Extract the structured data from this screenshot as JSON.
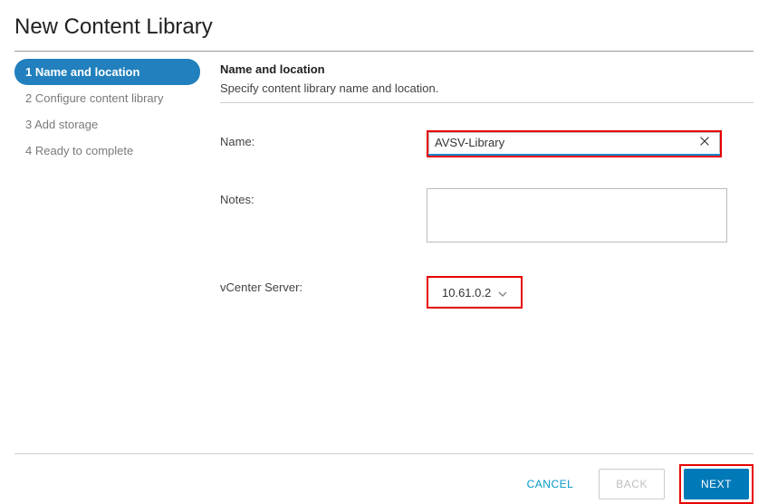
{
  "wizard": {
    "title": "New Content Library"
  },
  "steps": [
    {
      "num": "1",
      "label": "Name and location"
    },
    {
      "num": "2",
      "label": "Configure content library"
    },
    {
      "num": "3",
      "label": "Add storage"
    },
    {
      "num": "4",
      "label": "Ready to complete"
    }
  ],
  "section": {
    "title": "Name and location",
    "desc": "Specify content library name and location."
  },
  "form": {
    "name_label": "Name:",
    "name_value": "AVSV-Library",
    "notes_label": "Notes:",
    "notes_value": "",
    "vcenter_label": "vCenter Server:",
    "vcenter_value": "10.61.0.2"
  },
  "footer": {
    "cancel": "CANCEL",
    "back": "BACK",
    "next": "NEXT"
  }
}
